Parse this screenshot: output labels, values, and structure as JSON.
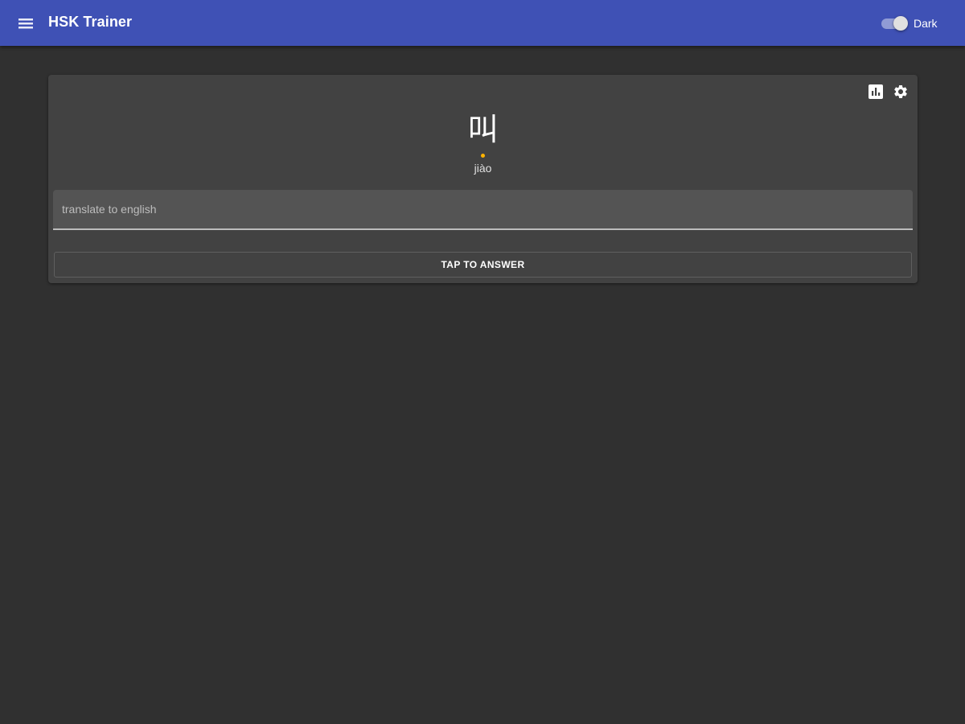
{
  "app": {
    "title": "HSK Trainer",
    "accent_color": "#3f51b5",
    "background_color": "#303030",
    "menu_icon": "hamburger-menu-icon"
  },
  "theme_toggle": {
    "label": "Dark",
    "checked": true
  },
  "card": {
    "background_color": "#424242",
    "icons": [
      "bar-chart-icon",
      "gear-icon"
    ],
    "character": "叫",
    "pinyin": "jiào",
    "tone_mark_color": "#ffb300",
    "answer_placeholder": "translate to english",
    "answer_value": "",
    "answer_button_label": "TAP TO ANSWER"
  }
}
